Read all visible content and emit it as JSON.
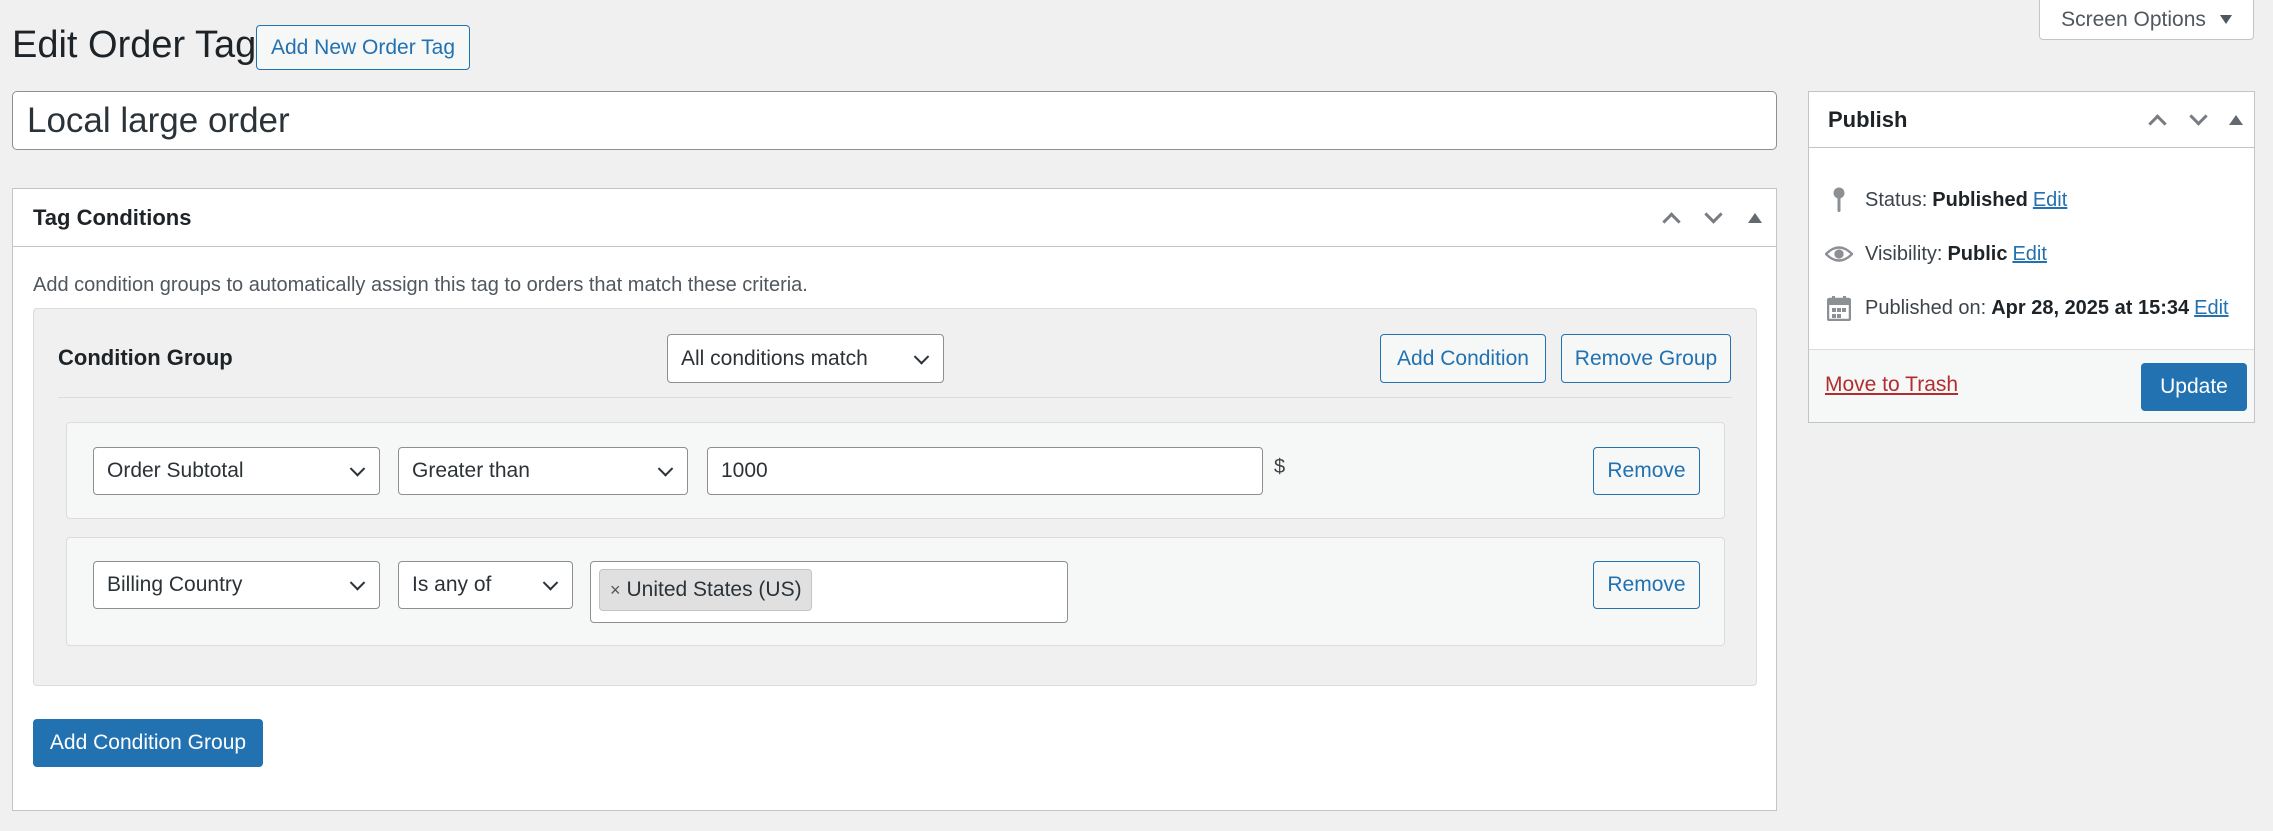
{
  "screen_options": {
    "label": "Screen Options"
  },
  "header": {
    "title": "Edit Order Tag",
    "add_new_label": "Add New Order Tag"
  },
  "title_field": {
    "value": "Local large order"
  },
  "tag_conditions": {
    "title": "Tag Conditions",
    "description": "Add condition groups to automatically assign this tag to orders that match these criteria.",
    "group": {
      "title": "Condition Group",
      "match_select": "All conditions match",
      "add_condition_label": "Add Condition",
      "remove_group_label": "Remove Group",
      "conditions": [
        {
          "field": "Order Subtotal",
          "operator": "Greater than",
          "value": "1000",
          "unit": "$",
          "remove_label": "Remove"
        },
        {
          "field": "Billing Country",
          "operator": "Is any of",
          "tags": [
            "United States (US)"
          ],
          "tag_remove": "×",
          "remove_label": "Remove"
        }
      ]
    },
    "add_group_label": "Add Condition Group"
  },
  "publish": {
    "title": "Publish",
    "status_label": "Status:",
    "status_value": "Published",
    "visibility_label": "Visibility:",
    "visibility_value": "Public",
    "published_label": "Published on:",
    "published_value": "Apr 28, 2025 at 15:34",
    "edit_label": "Edit",
    "trash_label": "Move to Trash",
    "update_label": "Update"
  },
  "colors": {
    "primary": "#2271b1",
    "danger": "#b32d2e",
    "background": "#f0f0f1"
  },
  "icons": [
    "caret-down-icon",
    "chevron-up-icon",
    "chevron-down-icon",
    "toggle-arrow-icon",
    "pin-icon",
    "eye-icon",
    "calendar-icon",
    "remove-tag-icon"
  ]
}
